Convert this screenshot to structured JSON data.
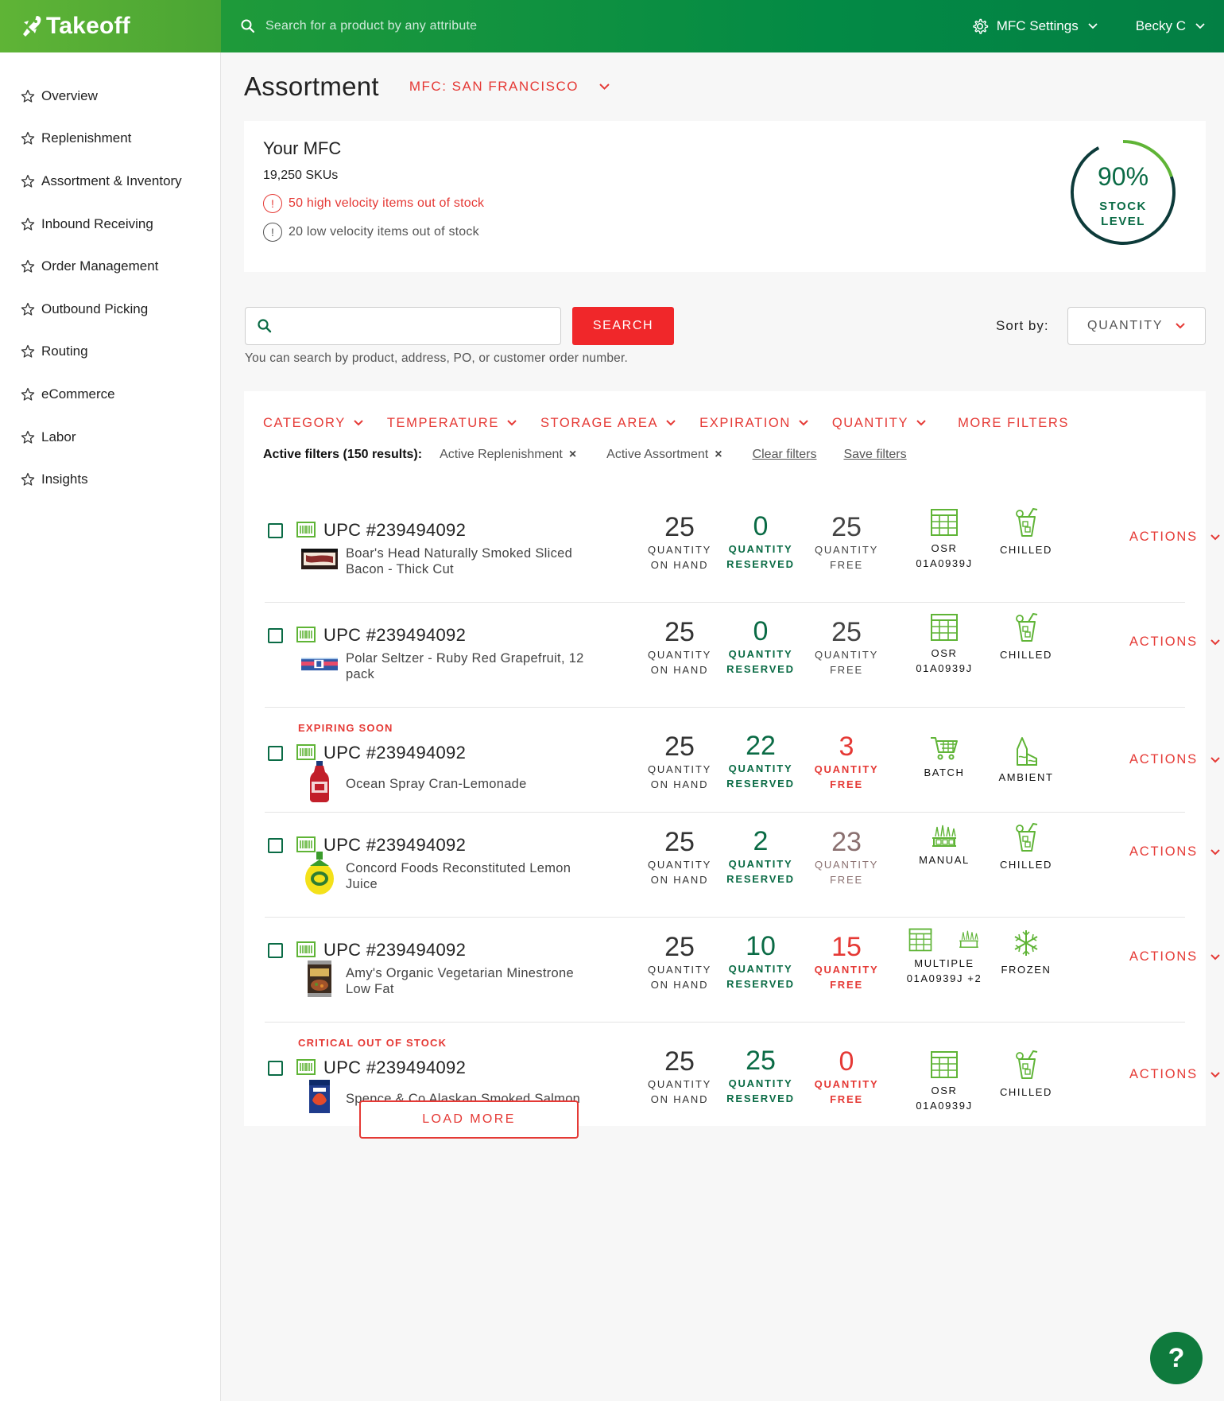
{
  "app": {
    "name": "Takeoff"
  },
  "topbar": {
    "search_placeholder": "Search for a product by any attribute",
    "settings_label": "MFC Settings",
    "user_name": "Becky C"
  },
  "sidebar": {
    "items": [
      {
        "label": "Overview"
      },
      {
        "label": "Replenishment"
      },
      {
        "label": "Assortment & Inventory"
      },
      {
        "label": "Inbound Receiving"
      },
      {
        "label": "Order Management"
      },
      {
        "label": "Outbound Picking"
      },
      {
        "label": "Routing"
      },
      {
        "label": "eCommerce"
      },
      {
        "label": "Labor"
      },
      {
        "label": "Insights"
      }
    ]
  },
  "page": {
    "title": "Assortment",
    "mfc_select": "MFC: SAN FRANCISCO"
  },
  "summary": {
    "title": "Your MFC",
    "skus": "19,250 SKUs",
    "alert_high": "50 high velocity items out of stock",
    "alert_low": "20 low velocity items out of stock",
    "alert_mark": "!",
    "stock_pct_text": "90%",
    "stock_fraction": 0.9,
    "stock_label_1": "STOCK",
    "stock_label_2": "LEVEL"
  },
  "search": {
    "value": "",
    "button_label": "SEARCH",
    "help": "You can search by product, address, PO, or customer order number.",
    "sort_label": "Sort by:",
    "sort_value": "QUANTITY"
  },
  "filters": {
    "items": [
      "CATEGORY",
      "TEMPERATURE",
      "STORAGE AREA",
      "EXPIRATION",
      "QUANTITY"
    ],
    "more": "MORE FILTERS",
    "active_label": "Active filters (150 results):",
    "chips": [
      "Active Replenishment",
      "Active Assortment"
    ],
    "chip_remove": "×",
    "clear": "Clear filters",
    "save": "Save filters"
  },
  "labels": {
    "qty_on_hand_1": "QUANTITY",
    "qty_on_hand_2": "ON HAND",
    "qty_reserved_1": "QUANTITY",
    "qty_reserved_2": "RESERVED",
    "qty_free_1": "QUANTITY",
    "qty_free_2": "FREE",
    "actions": "ACTIONS"
  },
  "products": [
    {
      "flag": "",
      "upc": "UPC #239494092",
      "name": "Boar's Head Naturally Smoked Sliced Bacon - Thick Cut",
      "on_hand": "25",
      "reserved": "0",
      "free": "25",
      "free_style": "normal",
      "storage": "OSR",
      "storage_code": "01A0939J",
      "storage_icon": "osr-icon",
      "temp": "CHILLED",
      "temp_icon": "chilled-icon",
      "thumb": "bacon"
    },
    {
      "flag": "",
      "upc": "UPC #239494092",
      "name": "Polar Seltzer - Ruby Red Grapefruit, 12 pack",
      "on_hand": "25",
      "reserved": "0",
      "free": "25",
      "free_style": "normal",
      "storage": "OSR",
      "storage_code": "01A0939J",
      "storage_icon": "osr-icon",
      "temp": "CHILLED",
      "temp_icon": "chilled-icon",
      "thumb": "seltzer"
    },
    {
      "flag": "EXPIRING SOON",
      "upc": "UPC #239494092",
      "name": "Ocean Spray Cran-Lemonade",
      "on_hand": "25",
      "reserved": "22",
      "free": "3",
      "free_style": "warn",
      "storage": "BATCH",
      "storage_code": "",
      "storage_icon": "cart-icon",
      "temp": "AMBIENT",
      "temp_icon": "ambient-icon",
      "thumb": "bottle"
    },
    {
      "flag": "",
      "upc": "UPC #239494092",
      "name": "Concord Foods Reconstituted Lemon Juice",
      "on_hand": "25",
      "reserved": "2",
      "free": "23",
      "free_style": "muted",
      "storage": "MANUAL",
      "storage_code": "",
      "storage_icon": "manual-icon",
      "temp": "CHILLED",
      "temp_icon": "chilled-icon",
      "thumb": "lemon"
    },
    {
      "flag": "",
      "upc": "UPC #239494092",
      "name": "Amy's Organic Vegetarian Minestrone Low Fat",
      "on_hand": "25",
      "reserved": "10",
      "free": "15",
      "free_style": "warn",
      "storage": "MULTIPLE",
      "storage_code": "01A0939J +2",
      "storage_icon": "multiple-icon",
      "temp": "FROZEN",
      "temp_icon": "frozen-icon",
      "thumb": "can"
    },
    {
      "flag": "CRITICAL OUT OF STOCK",
      "upc": "UPC #239494092",
      "name": "Spence & Co Alaskan Smoked Salmon",
      "on_hand": "25",
      "reserved": "25",
      "free": "0",
      "free_style": "warn",
      "storage": "OSR",
      "storage_code": "01A0939J",
      "storage_icon": "osr-icon",
      "temp": "CHILLED",
      "temp_icon": "chilled-icon",
      "thumb": "salmon"
    }
  ],
  "load_more": "LOAD MORE",
  "help_label": "?",
  "colors": {
    "brand_green": "#4aa534",
    "dark_green": "#0a6b45",
    "accent_red": "#e53935",
    "icon_green": "#5fb436"
  }
}
